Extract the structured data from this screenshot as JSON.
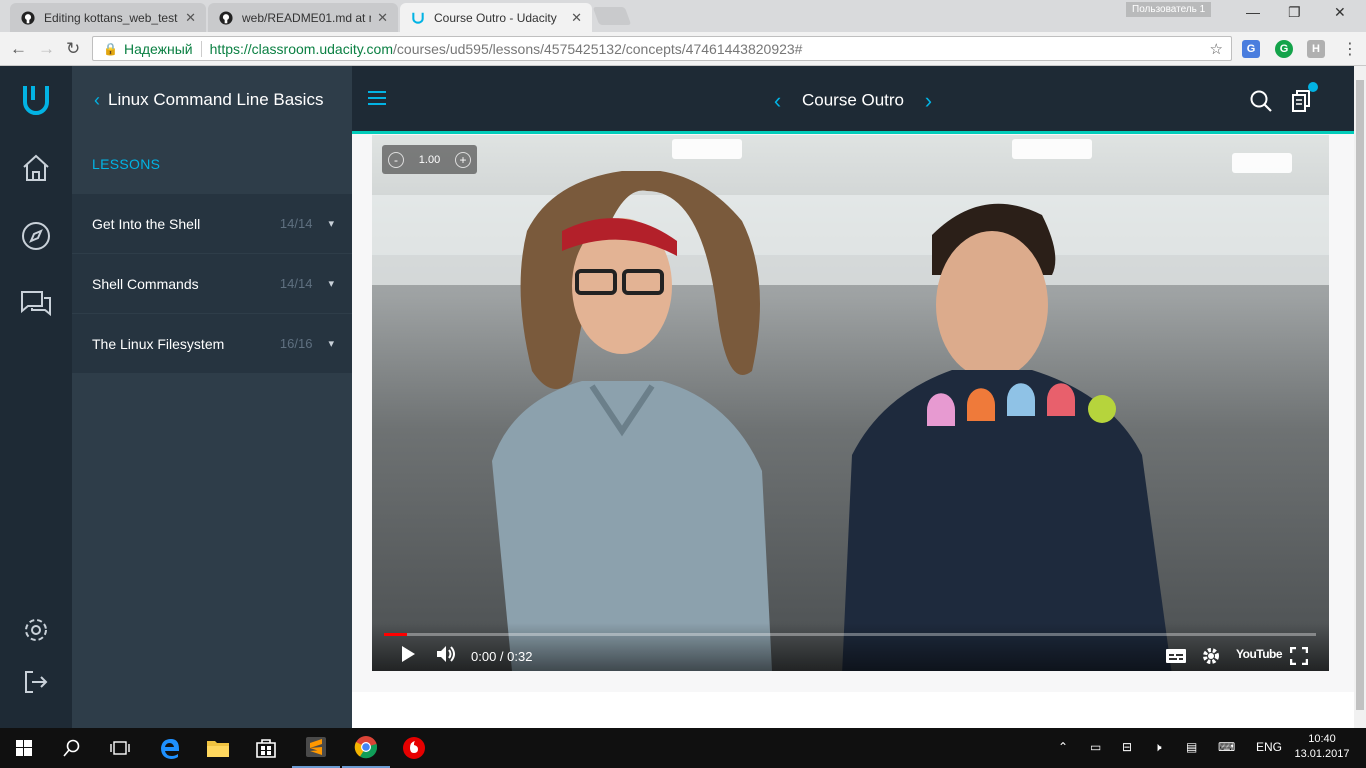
{
  "browser": {
    "tabs": [
      {
        "title": "Editing kottans_web_test",
        "icon": "github-icon"
      },
      {
        "title": "web/README01.md at m",
        "icon": "github-icon"
      },
      {
        "title": "Course Outro - Udacity",
        "icon": "udacity-icon",
        "active": true
      }
    ],
    "profile_label": "Пользователь 1",
    "secure_label": "Надежный",
    "url_host": "https://classroom.udacity.com",
    "url_path": "/courses/ud595/lessons/4575425132/concepts/47461443820923#",
    "extensions": [
      {
        "name": "google-translate-icon",
        "letter": "G",
        "color": "#4a7dde"
      },
      {
        "name": "grammarly-icon",
        "letter": "G",
        "color": "#14a34a"
      },
      {
        "name": "h-extension-icon",
        "letter": "H",
        "color": "#b0b0b0"
      }
    ]
  },
  "sidebar": {
    "course_title": "Linux Command Line Basics",
    "section_label": "LESSONS",
    "lessons": [
      {
        "name": "Get Into the Shell",
        "count": "14/14"
      },
      {
        "name": "Shell Commands",
        "count": "14/14"
      },
      {
        "name": "The Linux Filesystem",
        "count": "16/16"
      }
    ]
  },
  "topbar": {
    "concept_title": "Course Outro"
  },
  "video": {
    "speed": "1.00",
    "speed_minus": "-",
    "speed_plus": "+",
    "current_time": "0:00",
    "separator": " / ",
    "duration": "0:32",
    "progress_fraction": 0.025,
    "youtube_label": "YouTube"
  },
  "taskbar": {
    "language": "ENG",
    "time": "10:40",
    "date": "13.01.2017"
  },
  "colors": {
    "udacity_blue": "#02b3e4",
    "udacity_teal": "#02ccba",
    "rail_bg": "#1e2a35",
    "sidebar_bg": "#2e3d49"
  }
}
